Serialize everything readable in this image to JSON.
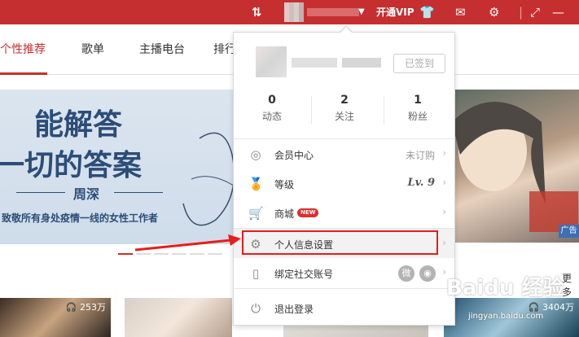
{
  "topbar": {
    "sync_icon": "sync-icon",
    "vip_label": "开通VIP",
    "tshirt_icon": "tshirt-icon",
    "mail_icon": "mail-icon",
    "gear_icon": "gear-icon",
    "mini_icon": "mini-mode-icon",
    "minimize_icon": "minimize-icon"
  },
  "tabs": [
    "个性推荐",
    "歌单",
    "主播电台",
    "排行"
  ],
  "banner": {
    "line1": "能解答",
    "line2": "一切的答案",
    "author": "周深",
    "tagline": "致敬所有身处疫情一线的女性工作者"
  },
  "ad_tag": "广告",
  "more_label": "更多",
  "tiles": [
    {
      "count": "253万"
    },
    {
      "count": "3404万"
    }
  ],
  "dropdown": {
    "signed_label": "已签到",
    "stats": [
      {
        "num": "0",
        "label": "动态"
      },
      {
        "num": "2",
        "label": "关注"
      },
      {
        "num": "1",
        "label": "粉丝"
      }
    ],
    "menu": [
      {
        "label": "会员中心",
        "value": "未订购",
        "icon": "vip-icon"
      },
      {
        "label": "等级",
        "value": "Lv. 9",
        "icon": "medal-icon"
      },
      {
        "label": "商城",
        "badge": "NEW",
        "icon": "cart-icon"
      },
      {
        "label": "个人信息设置",
        "icon": "gear-icon"
      },
      {
        "label": "绑定社交账号",
        "icon": "phone-icon"
      },
      {
        "label": "退出登录",
        "icon": "power-icon"
      }
    ]
  },
  "watermark": "Baidu 经验",
  "watermark_url": "jingyan.baidu.com",
  "colors": {
    "brand": "#c62f2f",
    "highlight_box": "#e81c1c",
    "arrow": "#e81c1c"
  }
}
